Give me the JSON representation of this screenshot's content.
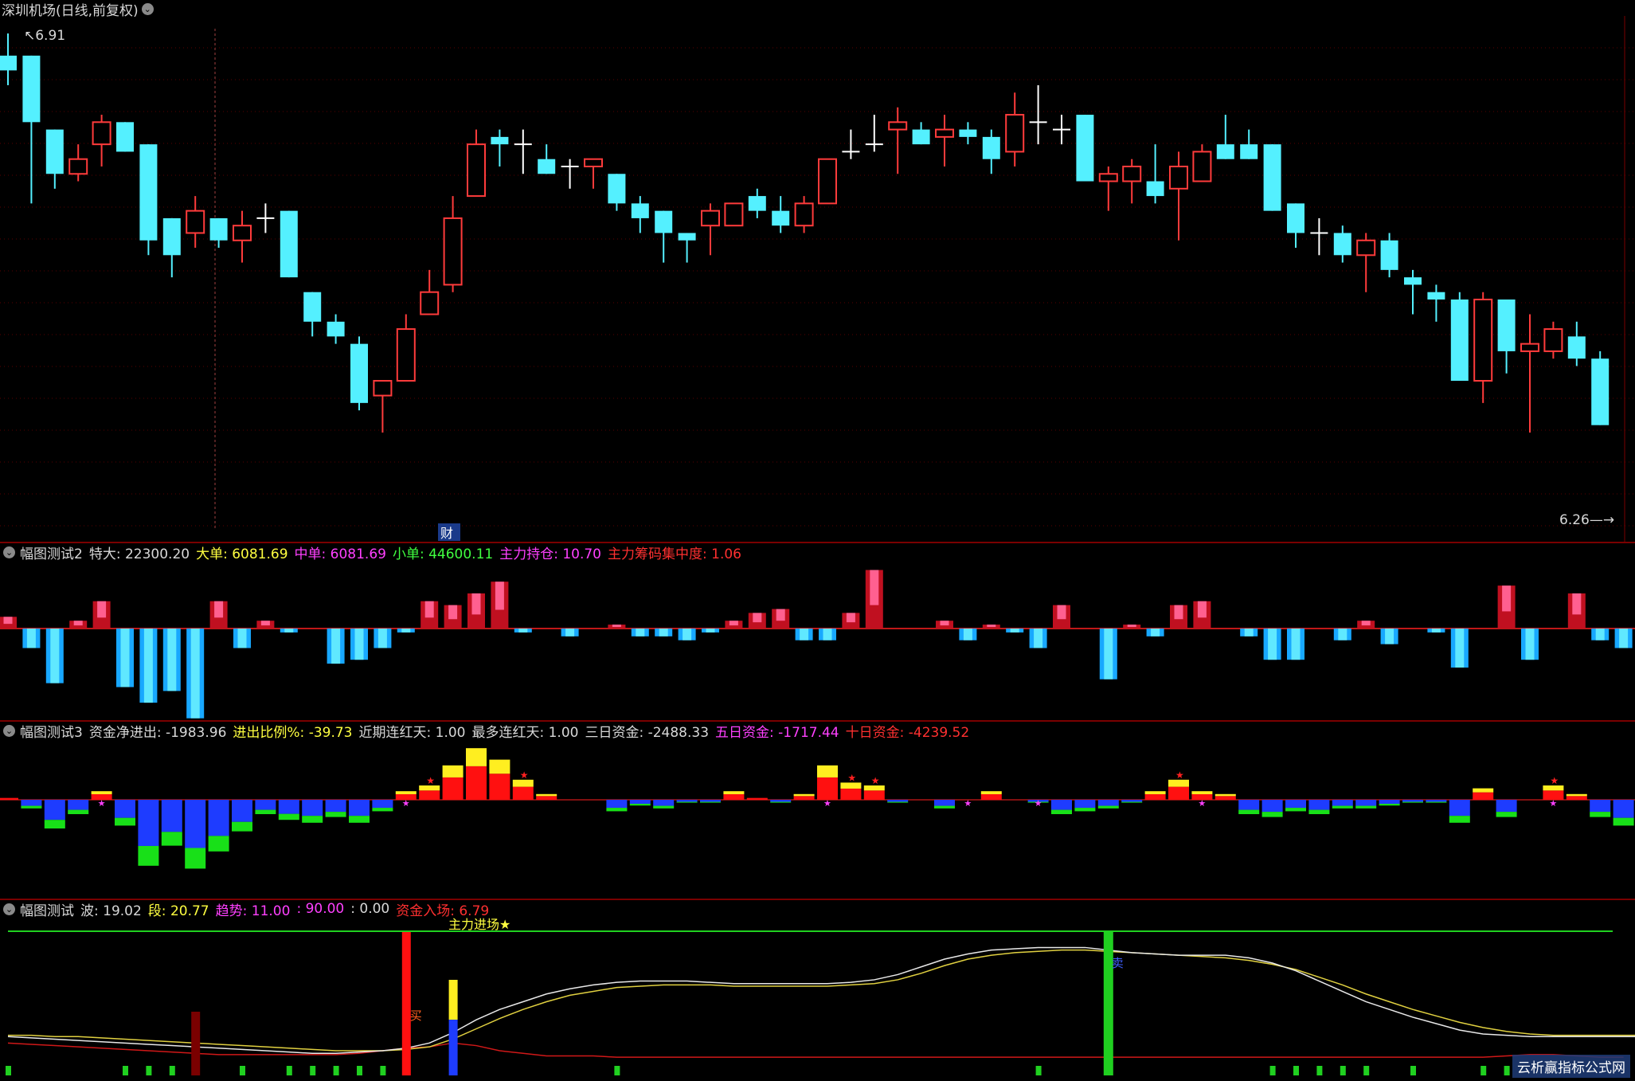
{
  "main_pane": {
    "title": "深圳机场(日线,前复权)",
    "high_label": "6.91",
    "low_label": "6.26",
    "finance_mark": "财",
    "up_color": "#ff3b3b",
    "down_color": "#54f0ff"
  },
  "pane2": {
    "name": "幅图测试2",
    "items": [
      {
        "label": "特大:",
        "value": "22300.20",
        "color": "#d8d8d8"
      },
      {
        "label": "大单:",
        "value": "6081.69",
        "color": "#ffff40"
      },
      {
        "label": "中单:",
        "value": "6081.69",
        "color": "#ff40ff"
      },
      {
        "label": "小单:",
        "value": "44600.11",
        "color": "#40ff40"
      },
      {
        "label": "主力持仓:",
        "value": "10.70",
        "color": "#ff40ff"
      },
      {
        "label": "主力筹码集中度:",
        "value": "1.06",
        "color": "#ff3030"
      }
    ]
  },
  "pane3": {
    "name": "幅图测试3",
    "items": [
      {
        "label": "资金净进出:",
        "value": "-1983.96",
        "color": "#d8d8d8"
      },
      {
        "label": "进出比例%:",
        "value": "-39.73",
        "color": "#ffff40"
      },
      {
        "label": "近期连红天:",
        "value": "1.00",
        "color": "#d8d8d8"
      },
      {
        "label": "最多连红天:",
        "value": "1.00",
        "color": "#d8d8d8"
      },
      {
        "label": "三日资金:",
        "value": "-2488.33",
        "color": "#d8d8d8"
      },
      {
        "label": "五日资金:",
        "value": "-1717.44",
        "color": "#ff40ff"
      },
      {
        "label": "十日资金:",
        "value": "-4239.52",
        "color": "#ff3030"
      }
    ]
  },
  "pane4": {
    "name": "幅图测试",
    "items": [
      {
        "label": "波:",
        "value": "19.02",
        "color": "#d8d8d8"
      },
      {
        "label": "段:",
        "value": "20.77",
        "color": "#ffff40"
      },
      {
        "label": "趋势:",
        "value": "11.00",
        "color": "#ff40ff"
      },
      {
        "label": ":",
        "value": "90.00",
        "color": "#ff40ff"
      },
      {
        "label": ":",
        "value": "0.00",
        "color": "#d8d8d8"
      },
      {
        "label": "资金入场:",
        "value": "6.79",
        "color": "#ff3030"
      }
    ],
    "line_label": "主力进场★",
    "buy_label": "买",
    "sell_label": "卖"
  },
  "watermark": "云析赢指标公式网",
  "chart_data": [
    {
      "type": "candlestick",
      "title": "深圳机场(日线,前复权)",
      "ylim": [
        6.26,
        6.91
      ],
      "candles": [
        {
          "o": 6.88,
          "h": 6.91,
          "l": 6.84,
          "c": 6.86
        },
        {
          "o": 6.88,
          "h": 6.88,
          "l": 6.68,
          "c": 6.79
        },
        {
          "o": 6.78,
          "h": 6.78,
          "l": 6.7,
          "c": 6.72
        },
        {
          "o": 6.72,
          "h": 6.76,
          "l": 6.71,
          "c": 6.74
        },
        {
          "o": 6.76,
          "h": 6.8,
          "l": 6.73,
          "c": 6.79
        },
        {
          "o": 6.79,
          "h": 6.79,
          "l": 6.75,
          "c": 6.75
        },
        {
          "o": 6.76,
          "h": 6.76,
          "l": 6.61,
          "c": 6.63
        },
        {
          "o": 6.66,
          "h": 6.66,
          "l": 6.58,
          "c": 6.61
        },
        {
          "o": 6.64,
          "h": 6.69,
          "l": 6.62,
          "c": 6.67
        },
        {
          "o": 6.66,
          "h": 6.66,
          "l": 6.62,
          "c": 6.63
        },
        {
          "o": 6.63,
          "h": 6.67,
          "l": 6.6,
          "c": 6.65
        },
        {
          "o": 6.66,
          "h": 6.68,
          "l": 6.64,
          "c": 6.66
        },
        {
          "o": 6.67,
          "h": 6.67,
          "l": 6.58,
          "c": 6.58
        },
        {
          "o": 6.56,
          "h": 6.56,
          "l": 6.5,
          "c": 6.52
        },
        {
          "o": 6.52,
          "h": 6.53,
          "l": 6.49,
          "c": 6.5
        },
        {
          "o": 6.49,
          "h": 6.5,
          "l": 6.4,
          "c": 6.41
        },
        {
          "o": 6.42,
          "h": 6.44,
          "l": 6.37,
          "c": 6.44
        },
        {
          "o": 6.44,
          "h": 6.53,
          "l": 6.44,
          "c": 6.51
        },
        {
          "o": 6.53,
          "h": 6.59,
          "l": 6.53,
          "c": 6.56
        },
        {
          "o": 6.57,
          "h": 6.69,
          "l": 6.56,
          "c": 6.66
        },
        {
          "o": 6.69,
          "h": 6.78,
          "l": 6.69,
          "c": 6.76
        },
        {
          "o": 6.77,
          "h": 6.78,
          "l": 6.73,
          "c": 6.76
        },
        {
          "o": 6.76,
          "h": 6.78,
          "l": 6.72,
          "c": 6.76
        },
        {
          "o": 6.74,
          "h": 6.76,
          "l": 6.72,
          "c": 6.72
        },
        {
          "o": 6.73,
          "h": 6.74,
          "l": 6.7,
          "c": 6.73
        },
        {
          "o": 6.73,
          "h": 6.74,
          "l": 6.7,
          "c": 6.74
        },
        {
          "o": 6.72,
          "h": 6.72,
          "l": 6.67,
          "c": 6.68
        },
        {
          "o": 6.68,
          "h": 6.69,
          "l": 6.64,
          "c": 6.66
        },
        {
          "o": 6.67,
          "h": 6.67,
          "l": 6.6,
          "c": 6.64
        },
        {
          "o": 6.64,
          "h": 6.64,
          "l": 6.6,
          "c": 6.63
        },
        {
          "o": 6.65,
          "h": 6.68,
          "l": 6.61,
          "c": 6.67
        },
        {
          "o": 6.65,
          "h": 6.68,
          "l": 6.65,
          "c": 6.68
        },
        {
          "o": 6.69,
          "h": 6.7,
          "l": 6.66,
          "c": 6.67
        },
        {
          "o": 6.67,
          "h": 6.69,
          "l": 6.64,
          "c": 6.65
        },
        {
          "o": 6.65,
          "h": 6.69,
          "l": 6.64,
          "c": 6.68
        },
        {
          "o": 6.68,
          "h": 6.74,
          "l": 6.68,
          "c": 6.74
        },
        {
          "o": 6.75,
          "h": 6.78,
          "l": 6.74,
          "c": 6.75
        },
        {
          "o": 6.76,
          "h": 6.8,
          "l": 6.75,
          "c": 6.76
        },
        {
          "o": 6.78,
          "h": 6.81,
          "l": 6.72,
          "c": 6.79
        },
        {
          "o": 6.78,
          "h": 6.79,
          "l": 6.76,
          "c": 6.76
        },
        {
          "o": 6.77,
          "h": 6.8,
          "l": 6.73,
          "c": 6.78
        },
        {
          "o": 6.78,
          "h": 6.79,
          "l": 6.76,
          "c": 6.77
        },
        {
          "o": 6.77,
          "h": 6.78,
          "l": 6.72,
          "c": 6.74
        },
        {
          "o": 6.75,
          "h": 6.83,
          "l": 6.73,
          "c": 6.8
        },
        {
          "o": 6.79,
          "h": 6.84,
          "l": 6.76,
          "c": 6.79
        },
        {
          "o": 6.78,
          "h": 6.8,
          "l": 6.76,
          "c": 6.78
        },
        {
          "o": 6.8,
          "h": 6.8,
          "l": 6.71,
          "c": 6.71
        },
        {
          "o": 6.71,
          "h": 6.73,
          "l": 6.67,
          "c": 6.72
        },
        {
          "o": 6.71,
          "h": 6.74,
          "l": 6.68,
          "c": 6.73
        },
        {
          "o": 6.71,
          "h": 6.76,
          "l": 6.68,
          "c": 6.69
        },
        {
          "o": 6.7,
          "h": 6.75,
          "l": 6.63,
          "c": 6.73
        },
        {
          "o": 6.71,
          "h": 6.76,
          "l": 6.71,
          "c": 6.75
        },
        {
          "o": 6.76,
          "h": 6.8,
          "l": 6.74,
          "c": 6.74
        },
        {
          "o": 6.76,
          "h": 6.78,
          "l": 6.74,
          "c": 6.74
        },
        {
          "o": 6.76,
          "h": 6.76,
          "l": 6.67,
          "c": 6.67
        },
        {
          "o": 6.68,
          "h": 6.68,
          "l": 6.62,
          "c": 6.64
        },
        {
          "o": 6.64,
          "h": 6.66,
          "l": 6.61,
          "c": 6.64
        },
        {
          "o": 6.64,
          "h": 6.65,
          "l": 6.6,
          "c": 6.61
        },
        {
          "o": 6.61,
          "h": 6.64,
          "l": 6.56,
          "c": 6.63
        },
        {
          "o": 6.63,
          "h": 6.64,
          "l": 6.58,
          "c": 6.59
        },
        {
          "o": 6.58,
          "h": 6.59,
          "l": 6.53,
          "c": 6.57
        },
        {
          "o": 6.56,
          "h": 6.57,
          "l": 6.52,
          "c": 6.55
        },
        {
          "o": 6.55,
          "h": 6.56,
          "l": 6.44,
          "c": 6.44
        },
        {
          "o": 6.44,
          "h": 6.56,
          "l": 6.41,
          "c": 6.55
        },
        {
          "o": 6.55,
          "h": 6.55,
          "l": 6.45,
          "c": 6.48
        },
        {
          "o": 6.48,
          "h": 6.53,
          "l": 6.37,
          "c": 6.49
        },
        {
          "o": 6.48,
          "h": 6.52,
          "l": 6.47,
          "c": 6.51
        },
        {
          "o": 6.5,
          "h": 6.52,
          "l": 6.46,
          "c": 6.47
        },
        {
          "o": 6.47,
          "h": 6.48,
          "l": 6.38,
          "c": 6.38
        }
      ]
    },
    {
      "type": "bar",
      "title": "幅图测试2",
      "values": [
        3,
        -5,
        -14,
        2,
        7,
        -15,
        -19,
        -16,
        -23,
        7,
        -5,
        2,
        -1,
        0,
        -9,
        -8,
        -5,
        -1,
        7,
        6,
        9,
        12,
        -1,
        0,
        -2,
        0,
        1,
        -2,
        -2,
        -3,
        -1,
        2,
        4,
        5,
        -3,
        -3,
        4,
        15,
        0,
        0,
        2,
        -3,
        1,
        -1,
        -5,
        6,
        0,
        -13,
        1,
        -2,
        6,
        7,
        0,
        -2,
        -8,
        -8,
        0,
        -3,
        2,
        -4,
        0,
        -1,
        -10,
        0,
        11,
        -8,
        0,
        9,
        -3,
        -5,
        -12
      ],
      "ylim": [
        -23,
        15
      ]
    },
    {
      "type": "bar",
      "title": "幅图测试3",
      "values": [
        1,
        -3,
        -10,
        -5,
        3,
        -9,
        -23,
        -16,
        -24,
        -18,
        -11,
        -5,
        -7,
        -8,
        -6,
        -8,
        -4,
        3,
        5,
        12,
        18,
        14,
        7,
        2,
        0,
        0,
        -4,
        -2,
        -3,
        -1,
        -1,
        3,
        1,
        -1,
        2,
        12,
        6,
        5,
        -1,
        0,
        -3,
        0,
        3,
        0,
        -1,
        -5,
        -4,
        -3,
        -1,
        3,
        7,
        3,
        2,
        -5,
        -6,
        -4,
        -5,
        -3,
        -3,
        -2,
        -1,
        -1,
        -8,
        4,
        -6,
        0,
        5,
        2,
        -6,
        -9
      ]
    },
    {
      "type": "line",
      "title": "幅图测试",
      "series": [
        {
          "name": "波",
          "values": [
            19,
            18,
            17,
            16,
            15,
            14,
            13,
            12,
            11,
            10,
            9,
            8,
            7,
            6,
            6,
            7,
            8,
            10,
            14,
            22,
            32,
            40,
            46,
            52,
            56,
            59,
            61,
            62,
            62,
            62,
            61,
            60,
            60,
            60,
            60,
            60,
            61,
            63,
            67,
            73,
            79,
            83,
            86,
            87,
            88,
            88,
            88,
            86,
            84,
            83,
            82,
            82,
            82,
            80,
            76,
            70,
            62,
            54,
            46,
            40,
            34,
            29,
            24,
            21,
            20,
            19,
            19,
            19,
            19,
            19,
            19
          ]
        },
        {
          "name": "段",
          "values": [
            20,
            20,
            19,
            19,
            18,
            17,
            16,
            15,
            14,
            13,
            12,
            11,
            10,
            9,
            8,
            8,
            8,
            9,
            11,
            17,
            25,
            33,
            40,
            46,
            51,
            54,
            57,
            58,
            59,
            59,
            59,
            58,
            58,
            58,
            58,
            58,
            59,
            60,
            63,
            68,
            74,
            79,
            82,
            84,
            85,
            86,
            86,
            85,
            84,
            83,
            82,
            81,
            80,
            78,
            75,
            71,
            65,
            59,
            52,
            46,
            40,
            35,
            30,
            26,
            23,
            21,
            20,
            20,
            20,
            20,
            20
          ]
        }
      ]
    }
  ]
}
